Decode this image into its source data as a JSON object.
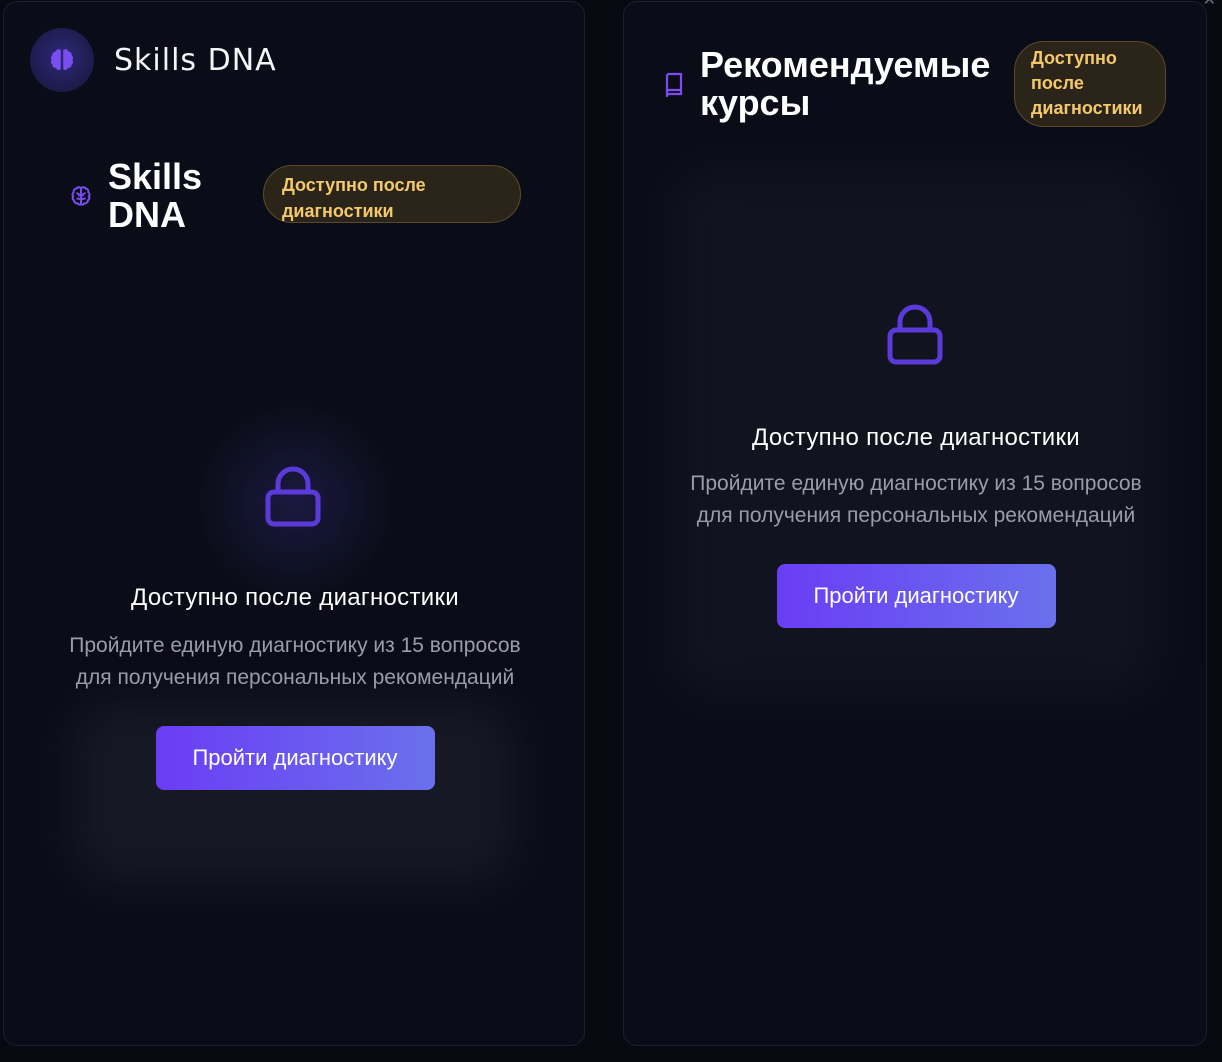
{
  "left_panel": {
    "brand_title": "Skills DNA",
    "section_title": "Skills DNA",
    "badge": "Доступно после диагностики",
    "locked_title": "Доступно после диагностики",
    "locked_description": "Пройдите единую диагностику из 15 вопросов для получения персональных рекомендаций",
    "cta_label": "Пройти диагностику"
  },
  "right_panel": {
    "section_title": "Рекомендуемые курсы",
    "badge": "Доступно после диагностики",
    "locked_title": "Доступно после диагностики",
    "locked_description": "Пройдите единую диагностику из 15 вопросов для получения персональных рекомендаций",
    "cta_label": "Пройти диагностику"
  },
  "icons": {
    "brand_logo": "brain-icon",
    "section_icon_left": "brain-icon",
    "section_icon_right": "book-icon",
    "lock": "lock-icon"
  },
  "colors": {
    "background": "#070910",
    "panel": "#0a0d18",
    "accent": "#6a3df5",
    "accent_end": "#6a70ec",
    "badge_text": "#f4c96b",
    "badge_bg": "#2b2418",
    "muted_text": "#9a9ca8"
  }
}
